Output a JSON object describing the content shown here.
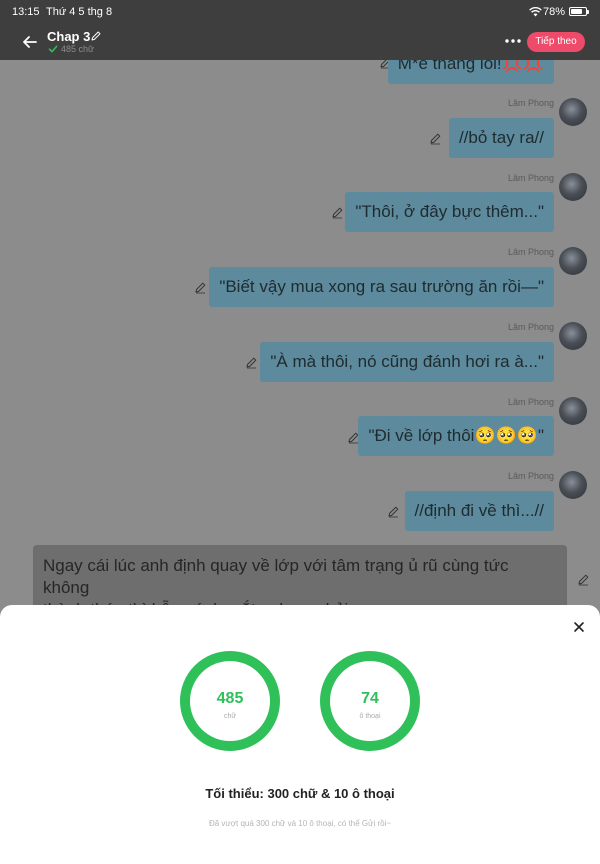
{
  "status_bar": {
    "time": "13:15",
    "date": "Thứ 4 5 thg 8",
    "battery": "78%",
    "battery_level": 0.78
  },
  "header": {
    "title": "Chap 3",
    "word_count": "485 chữ",
    "next_button": "Tiếp theo"
  },
  "messages": [
    {
      "sender": "",
      "text": "M*e thằng lồi!💢💢"
    },
    {
      "sender": "Lâm Phong",
      "text": "//bỏ tay ra//"
    },
    {
      "sender": "Lâm Phong",
      "text": "\"Thôi, ở đây bực thêm...\""
    },
    {
      "sender": "Lâm Phong",
      "text": "\"Biết vậy mua xong ra sau trường ăn rồi—\""
    },
    {
      "sender": "Lâm Phong",
      "text": "\"À mà thôi, nó cũng đánh hơi ra à...\""
    },
    {
      "sender": "Lâm Phong",
      "text": "\"Đi về lớp thôi🥺🥺🥺\""
    },
    {
      "sender": "Lâm Phong",
      "text": "//định đi về thì...//"
    }
  ],
  "narration": {
    "line1": "Ngay cái lúc anh định quay về lớp với tâm trạng ủ rũ cùng tức không",
    "line2": "thành thép thì bỗng ánh mắt anh va phải..."
  },
  "stats_sheet": {
    "words": {
      "value": "485",
      "label": "chữ"
    },
    "dialogues": {
      "value": "74",
      "label": "ô thoại"
    },
    "minimum": "Tối thiểu: 300 chữ & 10 ô thoại",
    "note": "Đã vượt quá 300 chữ và 10 ô thoại, có thể Gửi rồi~"
  },
  "colors": {
    "accent": "#ee4a6a",
    "ring": "#2fc05a",
    "bubble": "#5d8a9c",
    "overlay": "#8c8c8c"
  }
}
